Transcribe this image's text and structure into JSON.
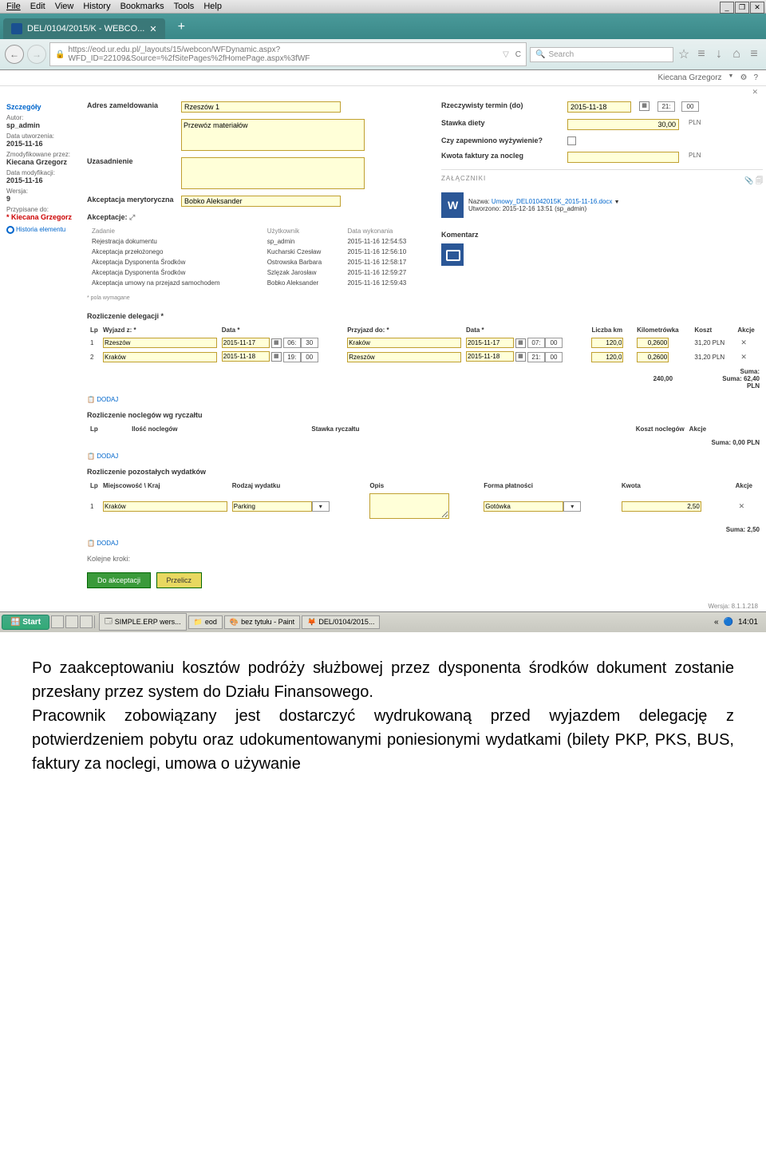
{
  "menu": {
    "file": "File",
    "edit": "Edit",
    "view": "View",
    "history": "History",
    "bookmarks": "Bookmarks",
    "tools": "Tools",
    "help": "Help"
  },
  "win": {
    "close": "✕"
  },
  "tab": {
    "title": "DEL/0104/2015/K - WEBCO...",
    "x": "✕",
    "add": "+"
  },
  "addr": {
    "back": "←",
    "url": "https://eod.ur.edu.pl/_layouts/15/webcon/WFDynamic.aspx?WFD_ID=22109&Source=%2fSitePages%2fHomePage.aspx%3fWF",
    "refresh": "C",
    "search_ph": "Search",
    "star": "☆",
    "list": "≡",
    "down": "↓",
    "home": "⌂",
    "menu": "≡"
  },
  "header": {
    "user": "Kiecana Grzegorz",
    "gear": "⚙",
    "help": "?",
    "close": "✕"
  },
  "sidebar": {
    "h": "Szczegóły",
    "author_l": "Autor:",
    "author_v": "sp_admin",
    "created_l": "Data utworzenia:",
    "created_v": "2015-11-16",
    "mod_l": "Zmodyfikowane przez:",
    "mod_v": "Kiecana Grzegorz",
    "moddate_l": "Data modyfikacji:",
    "moddate_v": "2015-11-16",
    "ver_l": "Wersja:",
    "ver_v": "9",
    "assign_l": "Przypisane do:",
    "assign_v": "Kiecana Grzegorz",
    "hist": "Historia elementu"
  },
  "left": {
    "addr_l": "Adres zameldowania",
    "addr_v": "Rzeszów 1",
    "mat_l": "",
    "mat_v": "Przewóz materiałów",
    "just_l": "Uzasadnienie",
    "just_v": "",
    "acc_l": "Akceptacja merytoryczna",
    "acc_v": "Bobko Aleksander",
    "acc_h": "Akceptacje:"
  },
  "steps_h": {
    "c1": "Zadanie",
    "c2": "Użytkownik",
    "c3": "Data wykonania"
  },
  "steps": [
    {
      "t": "Rejestracja dokumentu",
      "u": "sp_admin",
      "d": "2015-11-16 12:54:53"
    },
    {
      "t": "Akceptacja przełożonego",
      "u": "Kucharski Czesław",
      "d": "2015-11-16 12:56:10"
    },
    {
      "t": "Akceptacja Dysponenta Środków",
      "u": "Ostrowska Barbara",
      "d": "2015-11-16 12:58:17"
    },
    {
      "t": "Akceptacja Dysponenta Środków",
      "u": "Szlęzak Jarosław",
      "d": "2015-11-16 12:59:27"
    },
    {
      "t": "Akceptacja umowy na przejazd samochodem",
      "u": "Bobko Aleksander",
      "d": "2015-11-16 12:59:43"
    }
  ],
  "req_note": "* pola wymagane",
  "right": {
    "term_l": "Rzeczywisty termin (do)",
    "term_v": "2015-11-18",
    "th": "21:",
    "tm": "00",
    "rate_l": "Stawka diety",
    "rate_v": "30,00",
    "cur": "PLN",
    "food_l": "Czy zapewniono wyżywienie?",
    "hotel_l": "Kwota faktury za nocleg",
    "hotel_cur": "PLN"
  },
  "att": {
    "h": "ZAŁĄCZNIKI",
    "name_l": "Nazwa:",
    "name_v": "Umowy_DEL01042015K_2015-11-16.docx",
    "cr_l": "Utworzono:",
    "cr_v": "2015-12-16 13:51 (sp_admin)"
  },
  "kom_l": "Komentarz",
  "del": {
    "h": "Rozliczenie delegacji *",
    "c_lp": "Lp",
    "c_from": "Wyjazd z: *",
    "c_d1": "Data *",
    "c_to": "Przyjazd do: *",
    "c_d2": "Data *",
    "c_km": "Liczba km",
    "c_rate": "Kilometrówka",
    "c_cost": "Koszt",
    "c_act": "Akcje",
    "r1": {
      "lp": "1",
      "from": "Rzeszów",
      "d1": "2015-11-17",
      "h1": "06:",
      "m1": "30",
      "to": "Kraków",
      "d2": "2015-11-17",
      "h2": "07:",
      "m2": "00",
      "km": "120,0",
      "rate": "0,2600",
      "cost": "31,20",
      "cur": "PLN"
    },
    "r2": {
      "lp": "2",
      "from": "Kraków",
      "d1": "2015-11-18",
      "h1": "19:",
      "m1": "00",
      "to": "Rzeszów",
      "d2": "2015-11-18",
      "h2": "21:",
      "m2": "00",
      "km": "120,0",
      "rate": "0,2600",
      "cost": "31,20",
      "cur": "PLN"
    },
    "sum_km_l": "Suma:",
    "sum_km": "240,00",
    "sum_cost_l": "Suma: 62,40",
    "sum_cur": "PLN",
    "add": "DODAJ"
  },
  "noc": {
    "h": "Rozliczenie noclegów wg ryczałtu",
    "c_lp": "Lp",
    "c_n": "Ilość noclegów",
    "c_r": "Stawka ryczałtu",
    "c_k": "Koszt noclegów",
    "c_a": "Akcje",
    "sum": "Suma: 0,00 PLN",
    "add": "DODAJ"
  },
  "wyd": {
    "h": "Rozliczenie pozostałych wydatków",
    "c_lp": "Lp",
    "c_m": "Miejscowość \\ Kraj",
    "c_r": "Rodzaj wydatku",
    "c_o": "Opis",
    "c_f": "Forma płatności",
    "c_k": "Kwota",
    "c_a": "Akcje",
    "r1": {
      "lp": "1",
      "m": "Kraków",
      "r": "Parking",
      "f": "Gotówka",
      "k": "2,50"
    },
    "sum": "Suma: 2,50",
    "add": "DODAJ"
  },
  "next_l": "Kolejne kroki:",
  "btn1": "Do akceptacji",
  "btn2": "Przelicz",
  "version": "Wersja: 8.1.1.218",
  "taskbar": {
    "start": "Start",
    "i1": "SIMPLE.ERP wers...",
    "i2": "eod",
    "i3": "bez tytułu - Paint",
    "i4": "DEL/0104/2015...",
    "clock": "14:01"
  },
  "article": {
    "p1": "Po zaakceptowaniu kosztów podróży służbowej przez dysponenta środków dokument zostanie przesłany przez system do Działu Finansowego.",
    "p2": "Pracownik zobowiązany jest  dostarczyć wydrukowaną przed wyjazdem delegację z potwierdzeniem pobytu oraz udokumentowanymi poniesionymi wydatkami (bilety PKP, PKS, BUS, faktury za noclegi, umowa o używanie"
  }
}
